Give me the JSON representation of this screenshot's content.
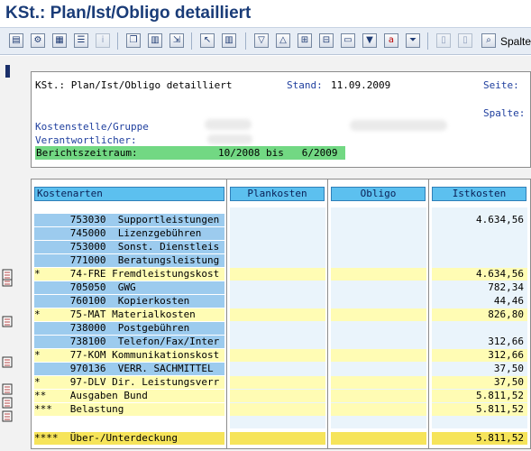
{
  "window": {
    "title": "KSt.: Plan/Ist/Obligo detailliert"
  },
  "toolbar": {
    "spalte_label": "Spalte"
  },
  "report": {
    "header_title": "KSt.: Plan/Ist/Obligo detailliert",
    "stand_label": "Stand:",
    "stand_value": "11.09.2009",
    "seite_label": "Seite:",
    "spalte_label": "Spalte:",
    "kostenstelle_label": "Kostenstelle/Gruppe",
    "verantwortlicher_label": "Verantwortlicher:",
    "berichtszeitraum_label": "Berichtszeitraum:",
    "berichtszeitraum_value": "10/2008 bis   6/2009"
  },
  "table": {
    "headers": {
      "kostenarten": "Kostenarten",
      "plankosten": "Plankosten",
      "obligo": "Obligo",
      "istkosten": "Istkosten"
    },
    "rows": [
      {
        "label": "      753030  Supportleistungen",
        "ist": "4.634,56",
        "type": "b"
      },
      {
        "label": "      745000  Lizenzgebühren",
        "ist": "",
        "type": "b"
      },
      {
        "label": "      753000  Sonst. Dienstleis",
        "ist": "",
        "type": "b"
      },
      {
        "label": "      771000  Beratungsleistung",
        "ist": "",
        "type": "b"
      },
      {
        "label": "*     74-FRE Fremdleistungskost",
        "ist": "4.634,56",
        "type": "y"
      },
      {
        "label": "      705050  GWG",
        "ist": "782,34",
        "type": "b"
      },
      {
        "label": "      760100  Kopierkosten",
        "ist": "44,46",
        "type": "b"
      },
      {
        "label": "*     75-MAT Materialkosten",
        "ist": "826,80",
        "type": "y"
      },
      {
        "label": "      738000  Postgebühren",
        "ist": "",
        "type": "b"
      },
      {
        "label": "      738100  Telefon/Fax/Inter",
        "ist": "312,66",
        "type": "b"
      },
      {
        "label": "*     77-KOM Kommunikationskost",
        "ist": "312,66",
        "type": "y"
      },
      {
        "label": "      970136  VERR. SACHMITTEL",
        "ist": "37,50",
        "type": "b"
      },
      {
        "label": "*     97-DLV Dir. Leistungsverr",
        "ist": "37,50",
        "type": "y"
      },
      {
        "label": "**    Ausgaben Bund",
        "ist": "5.811,52",
        "type": "y"
      },
      {
        "label": "***   Belastung",
        "ist": "5.811,52",
        "type": "y"
      }
    ],
    "total": {
      "label": "****  Über-/Unterdeckung",
      "ist": "5.811,52"
    }
  },
  "icons": [
    "hierarchy-icon",
    "settings-icon",
    "grid-icon",
    "list-icon",
    "info-icon",
    "copy-icon",
    "chart-icon",
    "export-icon",
    "cursor-icon",
    "columns-icon",
    "sort-desc-icon",
    "sort-asc-icon",
    "expand-icon",
    "collapse-icon",
    "filter-icon",
    "abc-icon",
    "funnel-icon",
    "doc-icon",
    "doc2-icon",
    "binoculars-icon"
  ]
}
